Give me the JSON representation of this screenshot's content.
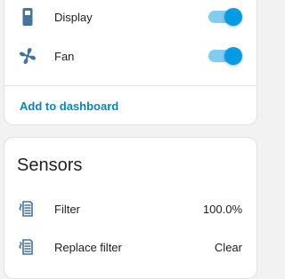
{
  "colors": {
    "accent": "#039be5",
    "link": "#0288b5",
    "icon": "#44739e"
  },
  "controls": {
    "items": [
      {
        "label": "Display",
        "icon": "display-icon",
        "on": true
      },
      {
        "label": "Fan",
        "icon": "fan-icon",
        "on": true
      }
    ],
    "action_label": "Add to dashboard"
  },
  "sensors": {
    "title": "Sensors",
    "items": [
      {
        "label": "Filter",
        "icon": "filter-icon",
        "value": "100.0%"
      },
      {
        "label": "Replace filter",
        "icon": "air-filter-icon",
        "value": "Clear"
      }
    ]
  }
}
